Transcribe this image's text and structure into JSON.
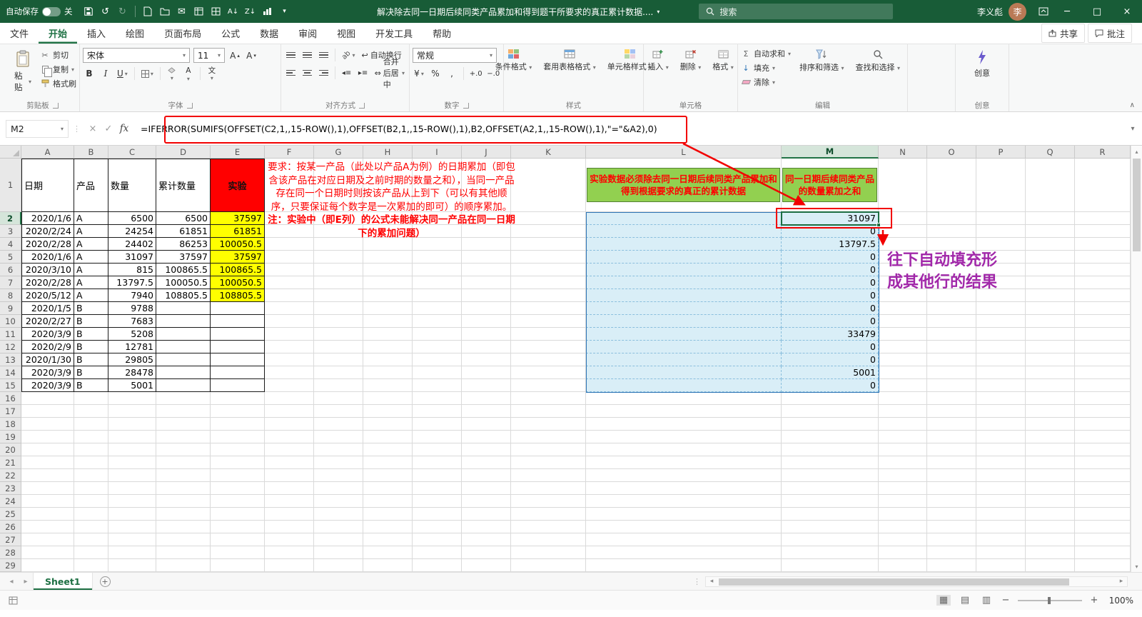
{
  "titlebar": {
    "autosave_label": "自动保存",
    "autosave_state": "关",
    "doc_title": "解决除去同一日期后续同类产品累加和得到题干所要求的真正累计数据....",
    "search_placeholder": "搜索",
    "user_name": "李义彪",
    "user_initial": "李"
  },
  "ribbon_tabs": {
    "tabs": [
      "文件",
      "开始",
      "插入",
      "绘图",
      "页面布局",
      "公式",
      "数据",
      "审阅",
      "视图",
      "开发工具",
      "帮助"
    ],
    "active": "开始",
    "share": "共享",
    "comments": "批注"
  },
  "ribbon": {
    "clipboard": {
      "group": "剪贴板",
      "paste": "粘贴",
      "cut": "剪切",
      "copy": "复制",
      "painter": "格式刷"
    },
    "font": {
      "group": "字体",
      "name": "宋体",
      "size": "11",
      "b": "B",
      "i": "I",
      "u": "U",
      "phonetic": "文"
    },
    "alignment": {
      "group": "对齐方式",
      "wrap": "自动换行",
      "merge": "合并后居中"
    },
    "number": {
      "group": "数字",
      "format": "常规",
      "currency": "¥",
      "percent": "%",
      "comma": ",",
      "inc_dec": "+.0",
      "dec_dec": "−.0"
    },
    "styles": {
      "group": "样式",
      "conditional": "条件格式",
      "table": "套用表格格式",
      "cell": "单元格样式"
    },
    "cells": {
      "group": "单元格",
      "insert": "插入",
      "delete": "删除",
      "format": "格式"
    },
    "editing": {
      "group": "编辑",
      "autosum": "自动求和",
      "fill": "填充",
      "clear": "清除",
      "sort": "排序和筛选",
      "find": "查找和选择"
    },
    "ideas": {
      "group": "创意",
      "button": "创意"
    }
  },
  "formula_bar": {
    "name_box": "M2",
    "fx": "fx",
    "formula": "=IFERROR(SUMIFS(OFFSET(C2,1,,15-ROW(),1),OFFSET(B2,1,,15-ROW(),1),B2,OFFSET(A2,1,,15-ROW(),1),\"=\"&A2),0)"
  },
  "grid": {
    "columns": [
      "A",
      "B",
      "C",
      "D",
      "E",
      "F",
      "G",
      "H",
      "I",
      "J",
      "K",
      "L",
      "M",
      "N",
      "O",
      "P",
      "Q",
      "R"
    ],
    "rows_visible": 29,
    "selection": {
      "cell": "M2",
      "column": "M",
      "row": 2
    },
    "table": {
      "headers": [
        "日期",
        "产品",
        "数量",
        "累计数量",
        "实验"
      ],
      "rows": [
        [
          "2020/1/6",
          "A",
          "6500",
          "6500",
          "37597"
        ],
        [
          "2020/2/24",
          "A",
          "24254",
          "61851",
          "61851"
        ],
        [
          "2020/2/28",
          "A",
          "24402",
          "86253",
          "100050.5"
        ],
        [
          "2020/1/6",
          "A",
          "31097",
          "37597",
          "37597"
        ],
        [
          "2020/3/10",
          "A",
          "815",
          "100865.5",
          "100865.5"
        ],
        [
          "2020/2/28",
          "A",
          "13797.5",
          "100050.5",
          "100050.5"
        ],
        [
          "2020/5/12",
          "A",
          "7940",
          "108805.5",
          "108805.5"
        ],
        [
          "2020/1/5",
          "B",
          "9788",
          "",
          ""
        ],
        [
          "2020/2/27",
          "B",
          "7683",
          "",
          ""
        ],
        [
          "2020/3/9",
          "B",
          "5208",
          "",
          ""
        ],
        [
          "2020/2/9",
          "B",
          "12781",
          "",
          ""
        ],
        [
          "2020/1/30",
          "B",
          "29805",
          "",
          ""
        ],
        [
          "2020/3/9",
          "B",
          "28478",
          "",
          ""
        ],
        [
          "2020/3/9",
          "B",
          "5001",
          "",
          ""
        ]
      ]
    },
    "requirement_note_main": "要求：按某一产品（此处以产品A为例）的日期累加（即包含该产品在对应日期及之前时期的数量之和），当同一产品存在同一个日期时则按该产品从上到下（可以有其他顺序，只要保证每个数字是一次累加的即可）的顺序累加。",
    "requirement_note_bold": "注：实验中（即E列）的公式未能解决同一产品在同一日期下的累加问题）",
    "green_header_L": "实验数据必须除去同一日期后续同类产品累加和得到根据要求的真正的累计数据",
    "green_header_M": "同一日期后续同类产品的数量累加之和",
    "m_values": [
      "31097",
      "0",
      "13797.5",
      "0",
      "0",
      "0",
      "0",
      "0",
      "0",
      "33479",
      "0",
      "0",
      "5001",
      "0"
    ]
  },
  "annotations": {
    "fill_note_line1": "往下自动填充形",
    "fill_note_line2": "成其他行的结果"
  },
  "sheet_bar": {
    "tabs": [
      "Sheet1"
    ]
  },
  "status_bar": {
    "zoom": "100%"
  },
  "colors": {
    "titlebar_green": "#185c37",
    "accent_green": "#217346",
    "header_red": "#ff0000",
    "highlight_yellow": "#ffff00",
    "note_green": "#92d050",
    "region_blue": "#d9eef7",
    "annotation_red": "#f20000",
    "annotation_purple": "#a128a9"
  }
}
